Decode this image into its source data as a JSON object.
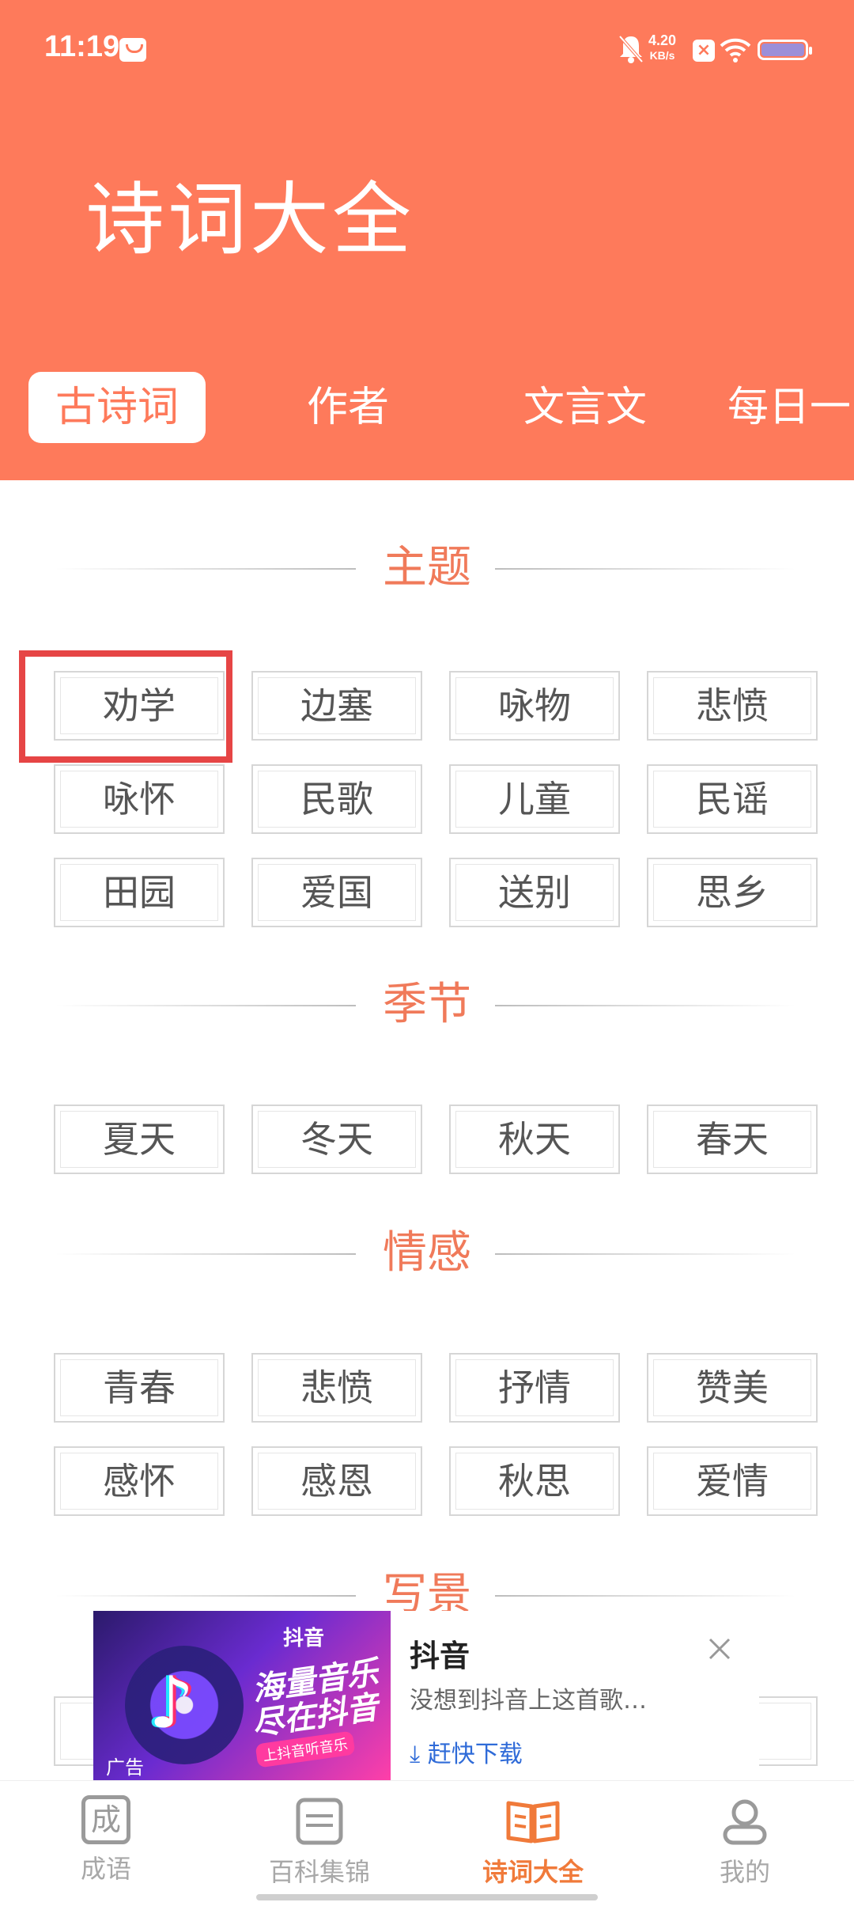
{
  "status_bar": {
    "time": "11:19",
    "net_speed_value": "4.20",
    "net_speed_unit": "KB/s",
    "icons": [
      "message-icon",
      "bell-off-icon",
      "close-box-icon",
      "wifi-icon",
      "battery-icon"
    ]
  },
  "app_title": "诗词大全",
  "tabs": [
    {
      "label": "古诗词",
      "active": true
    },
    {
      "label": "作者",
      "active": false
    },
    {
      "label": "文言文",
      "active": false
    },
    {
      "label": "每日一",
      "active": false
    }
  ],
  "sections": [
    {
      "title": "主题",
      "items": [
        "劝学",
        "边塞",
        "咏物",
        "悲愤",
        "咏怀",
        "民歌",
        "儿童",
        "民谣",
        "田园",
        "爱国",
        "送别",
        "思乡"
      ]
    },
    {
      "title": "季节",
      "items": [
        "夏天",
        "冬天",
        "秋天",
        "春天"
      ]
    },
    {
      "title": "情感",
      "items": [
        "青春",
        "悲愤",
        "抒情",
        "赞美",
        "感怀",
        "感恩",
        "秋思",
        "爱情"
      ]
    },
    {
      "title": "写景",
      "items": []
    }
  ],
  "ad": {
    "image_brand": "抖音",
    "image_slogan_1": "海量音乐",
    "image_slogan_2": "尽在抖音",
    "image_sub": "上抖音听音乐",
    "ad_tag": "广告",
    "name": "抖音",
    "description": "没想到抖音上这首歌…",
    "cta": "赶快下载"
  },
  "bottom_nav": [
    {
      "label": "成语",
      "icon": "成",
      "active": false
    },
    {
      "label": "百科集锦",
      "icon": "book-icon",
      "active": false
    },
    {
      "label": "诗词大全",
      "icon": "open-book-icon",
      "active": true
    },
    {
      "label": "我的",
      "icon": "person-icon",
      "active": false
    }
  ],
  "colors": {
    "header": "#FE7A5B",
    "accent": "#F07A5A",
    "highlight": "#E64545",
    "cta": "#2F6BD8"
  }
}
